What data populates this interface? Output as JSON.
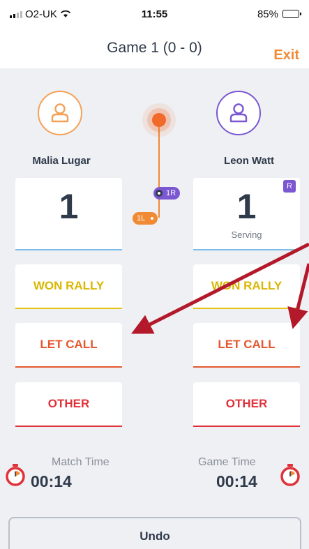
{
  "status_bar": {
    "carrier": "O2-UK",
    "time": "11:55",
    "battery": "85%",
    "battery_level": 0.85
  },
  "header": {
    "title": "Game 1 (0 - 0)",
    "exit_label": "Exit"
  },
  "players": {
    "left": {
      "name": "Malia Lugar",
      "score": "1",
      "color": "#f4a158"
    },
    "right": {
      "name": "Leon Watt",
      "score": "1",
      "status": "Serving",
      "badge": "R",
      "color": "#7b57d1"
    }
  },
  "serve_indicator": {
    "right_label": "1R",
    "left_label": "1L"
  },
  "actions": {
    "won_rally": "WON RALLY",
    "let_call": "LET CALL",
    "other": "OTHER"
  },
  "timers": {
    "match_label": "Match Time",
    "match_value": "00:14",
    "game_label": "Game Time",
    "game_value": "00:14"
  },
  "footer": {
    "undo_label": "Undo"
  },
  "colors": {
    "accent_orange": "#f08a34",
    "accent_purple": "#7b57d1",
    "annotation_arrow": "#b3192a"
  }
}
